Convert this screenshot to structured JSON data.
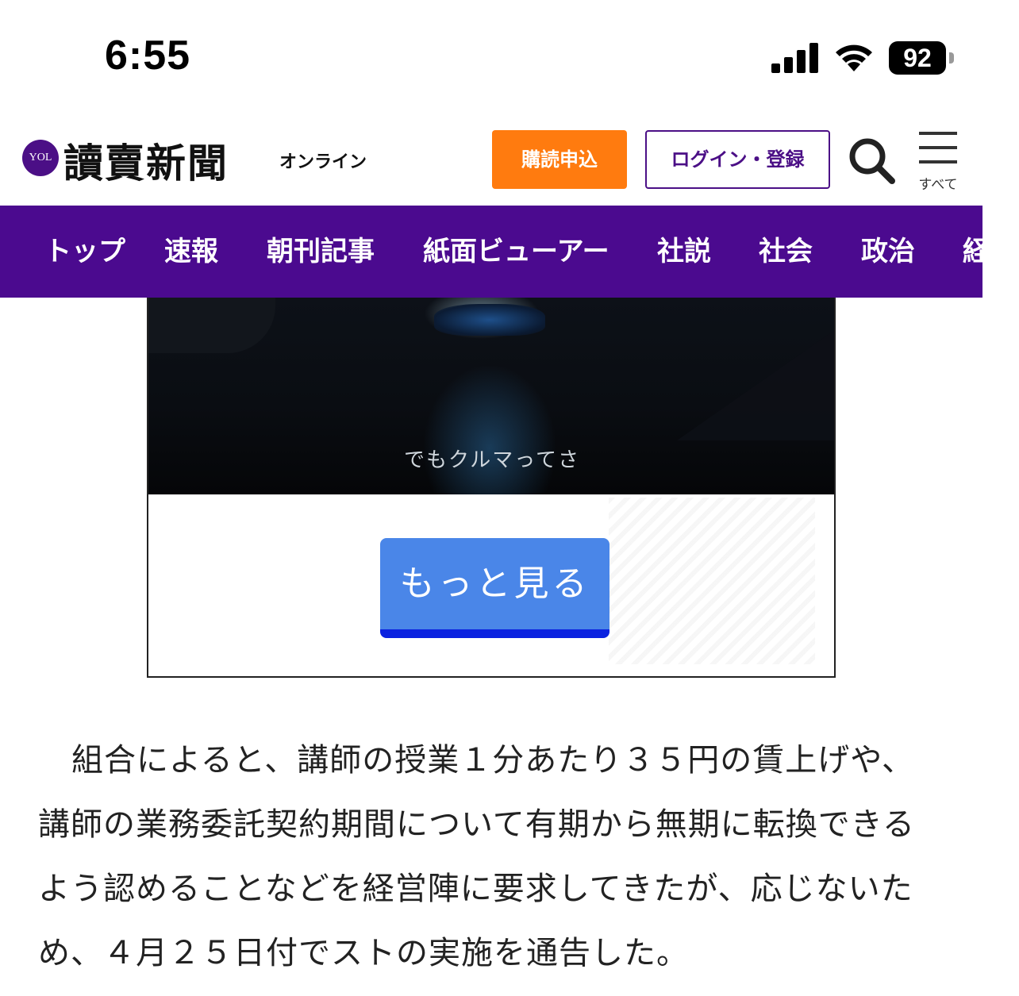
{
  "status_bar": {
    "time": "6:55",
    "battery": "92",
    "icons": [
      "signal-bars-icon",
      "wifi-icon",
      "battery-icon"
    ]
  },
  "header": {
    "logo_badge": "YOL",
    "logo_text": "讀賣新聞",
    "logo_sub": "オンライン",
    "subscribe_label": "購読申込",
    "login_label": "ログイン・登録",
    "menu_label": "すべて",
    "icons": [
      "search-icon",
      "hamburger-menu-icon"
    ]
  },
  "nav": {
    "items": [
      "トップ",
      "速報",
      "朝刊記事",
      "紙面ビューアー",
      "社説",
      "社会",
      "政治",
      "経"
    ]
  },
  "ad": {
    "caption": "でもクルマってさ",
    "more_label": "もっと見る"
  },
  "article": {
    "paragraph": "組合によると、講師の授業１分あたり３５円の賃上げや、講師の業務委託契約期間について有期から無期に転換できるよう認めることなどを経営陣に要求してきたが、応じないため、４月２５日付でストの実施を通告した。"
  },
  "colors": {
    "brand_purple": "#4b0a8f",
    "subscribe_orange": "#ff7b0f",
    "more_button_blue": "#4a86e8",
    "more_button_underline": "#0b22e0"
  }
}
